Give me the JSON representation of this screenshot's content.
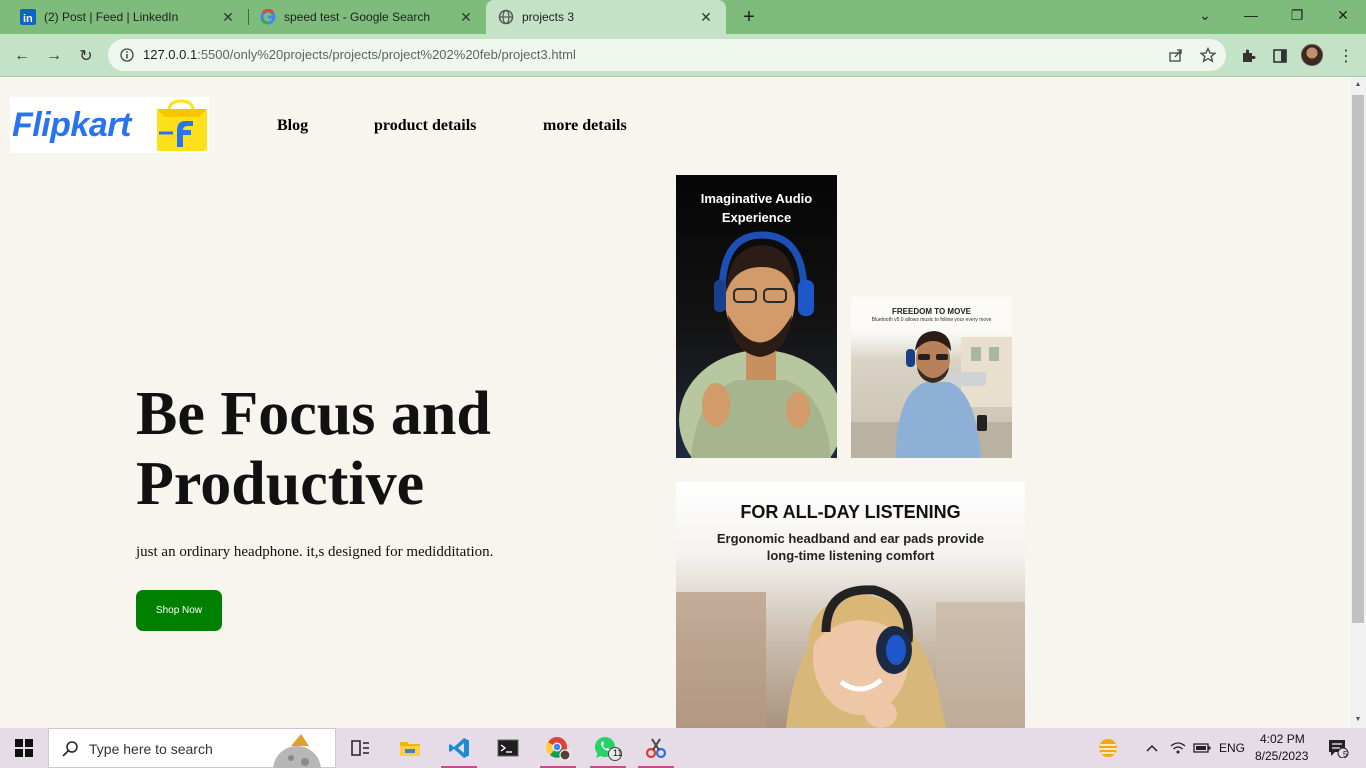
{
  "browser": {
    "tabs": [
      {
        "title": "(2) Post | Feed | LinkedIn",
        "icon": "linkedin-icon",
        "active": false
      },
      {
        "title": "speed test - Google Search",
        "icon": "google-icon",
        "active": false
      },
      {
        "title": "projects 3",
        "icon": "globe-icon",
        "active": true
      }
    ],
    "url_host": "127.0.0.1",
    "url_rest": ":5500/only%20projects/projects/project%202%20feb/project3.html"
  },
  "site": {
    "logo_text": "Flipkart",
    "nav": [
      "Blog",
      "product details",
      "more details"
    ],
    "hero_title": "Be Focus and Productive",
    "hero_subtitle": "just an ordinary headphone. it,s designed for medidditation.",
    "cta": "Shop Now",
    "images": [
      {
        "caption": "Imaginative Audio Experience"
      },
      {
        "caption": "FREEDOM TO MOVE",
        "subcaption": "Bluetooth v5.0 allows music to follow your every move"
      },
      {
        "caption": "FOR ALL-DAY LISTENING",
        "subcaption": "Ergonomic headband and ear pads provide long-time listening comfort"
      }
    ]
  },
  "taskbar": {
    "search_placeholder": "Type here to search",
    "whatsapp_badge": "11",
    "language": "ENG",
    "time": "4:02 PM",
    "date": "8/25/2023",
    "notification_count": "5"
  },
  "colors": {
    "tab_strip": "#7ebc7c",
    "toolbar": "#c4e3c6",
    "page_bg": "#f8f4ee",
    "cta_bg": "#008000",
    "logo_blue": "#2874f0",
    "logo_yellow": "#ffe11b"
  }
}
